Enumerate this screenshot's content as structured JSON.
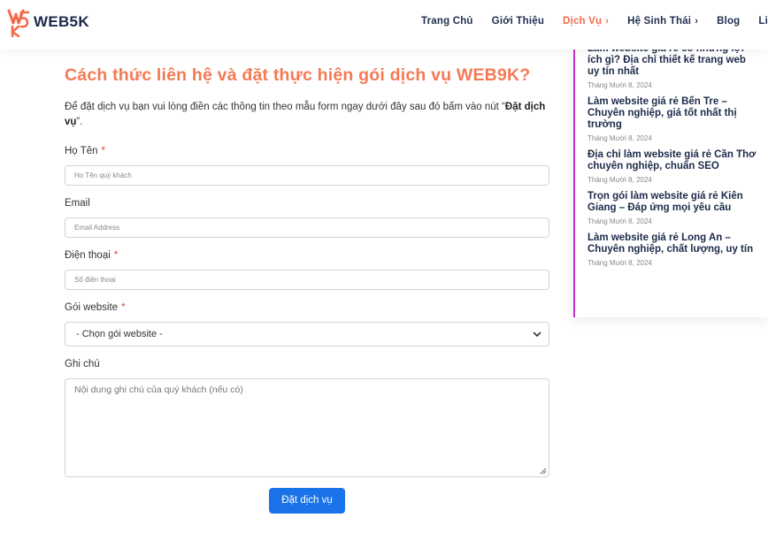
{
  "header": {
    "logo_text": "WEB5K",
    "nav": [
      {
        "label": "Trang Chủ",
        "active": false,
        "has_children": false
      },
      {
        "label": "Giới Thiệu",
        "active": false,
        "has_children": false
      },
      {
        "label": "Dịch Vụ",
        "active": true,
        "has_children": true
      },
      {
        "label": "Hệ Sinh Thái",
        "active": false,
        "has_children": true
      },
      {
        "label": "Blog",
        "active": false,
        "has_children": false
      },
      {
        "label": "Li",
        "active": false,
        "has_children": false
      }
    ],
    "chevron": "›"
  },
  "form": {
    "title": "Cách thức liên hệ và đặt thực hiện gói dịch vụ WEB9K?",
    "intro_prefix": "Để đặt dịch vụ bạn vui lòng điền các thông tin theo mẫu form ngay dưới đây sau đó bấm vào nút “",
    "intro_bold": "Đặt dịch vụ",
    "intro_suffix": "”.",
    "required_mark": "*",
    "fields": {
      "name": {
        "label": "Họ Tên",
        "placeholder": "Ho Tên quý khách",
        "required": true
      },
      "email": {
        "label": "Email",
        "placeholder": "Email Address",
        "required": false
      },
      "phone": {
        "label": "Điện thoại",
        "placeholder": "Số điện thoại",
        "required": true
      },
      "package": {
        "label": "Gói website",
        "selected": "- Chọn gói website -",
        "required": true
      },
      "note": {
        "label": "Ghi chú",
        "placeholder": "Nội dung ghi chú của quý khách (nếu có)",
        "required": false
      }
    },
    "submit_label": "Đặt dịch vụ"
  },
  "sidebar": {
    "posts": [
      {
        "title": "Làm website giá rẻ có những lợi ích gì? Địa chỉ thiết kế trang web uy tín nhất",
        "date": "Tháng Mười 8, 2024"
      },
      {
        "title": "Làm website giá rẻ Bến Tre – Chuyên nghiệp, giá tốt nhất thị trường",
        "date": "Tháng Mười 8, 2024"
      },
      {
        "title": "Địa chỉ làm website giá rẻ Cần Thơ chuyên nghiệp, chuẩn SEO",
        "date": "Tháng Mười 8, 2024"
      },
      {
        "title": "Trọn gói làm website giá rẻ Kiên Giang – Đáp ứng mọi yêu cầu",
        "date": "Tháng Mười 8, 2024"
      },
      {
        "title": "Làm website giá rẻ Long An – Chuyên nghiệp, chất lượng, uy tín",
        "date": "Tháng Mười 8, 2024"
      }
    ]
  },
  "colors": {
    "accent": "#f47a55",
    "nav_active": "#f26b4a",
    "button": "#1a73e8",
    "sidebar_border": "#c930c9",
    "dark_text": "#1c2a4a"
  }
}
